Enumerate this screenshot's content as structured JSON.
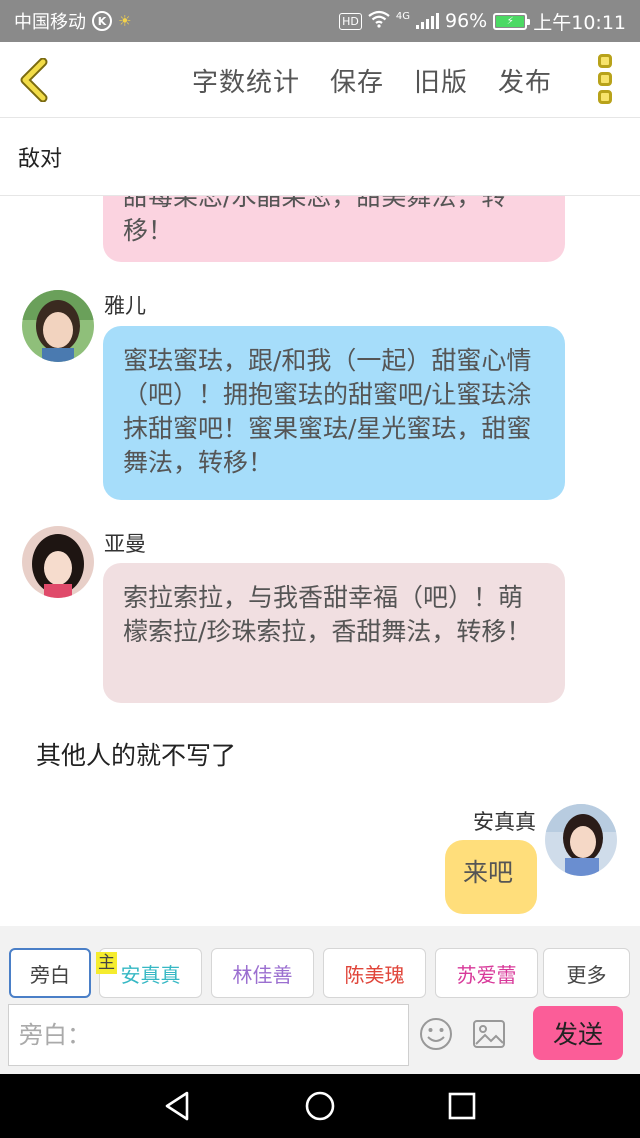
{
  "status_bar": {
    "carrier": "中国移动",
    "k_badge": "K",
    "hd": "HD",
    "network": "4G",
    "battery_percent": "96%",
    "time": "上午10:11",
    "icons": [
      "bulb-icon",
      "wifi-icon",
      "signal-icon",
      "battery-icon"
    ]
  },
  "toolbar": {
    "back_icon": "chevron-left-icon",
    "word_count_label": "字数统计",
    "save_label": "保存",
    "old_version_label": "旧版",
    "publish_label": "发布",
    "more_icon": "more-vertical-icon",
    "accent_color": "#e0c420"
  },
  "title": "敌对",
  "messages": [
    {
      "speaker": "",
      "text": "甜莓果恋/水晶果恋，甜美舞法，转移！",
      "visible_text": "转移！",
      "color": "#fbd3e0",
      "side": "left"
    },
    {
      "speaker": "雅儿",
      "text": "蜜珐蜜珐，跟/和我（一起）甜蜜心情（吧）！拥抱蜜珐的甜蜜吧/让蜜珐涂抹甜蜜吧！蜜果蜜珐/星光蜜珐，甜蜜舞法，转移！",
      "color": "#a6ddfa",
      "side": "left"
    },
    {
      "speaker": "亚曼",
      "text": "索拉索拉，与我香甜幸福（吧）！萌檬索拉/珍珠索拉，香甜舞法，转移！",
      "color": "#f1dfe1",
      "side": "left"
    },
    {
      "narration": "其他人的就不写了"
    },
    {
      "speaker": "安真真",
      "text": "来吧",
      "color": "#ffde7b",
      "side": "right"
    }
  ],
  "roles": {
    "main_tag": "主",
    "chips": [
      {
        "label": "旁白",
        "color": "#444444",
        "active": true
      },
      {
        "label": "安真真",
        "color": "#36b8c4",
        "active": false
      },
      {
        "label": "林佳善",
        "color": "#9b6fd0",
        "active": false
      },
      {
        "label": "陈美瑰",
        "color": "#e0453a",
        "active": false
      },
      {
        "label": "苏爱蕾",
        "color": "#d83a9a",
        "active": false
      },
      {
        "label": "更多",
        "color": "#444444",
        "active": false
      }
    ]
  },
  "input": {
    "placeholder": "旁白：",
    "value": "",
    "emoji_icon": "emoji-icon",
    "image_icon": "image-icon",
    "send_label": "发送",
    "send_color": "#fb5d98"
  },
  "navbar": {
    "back_icon": "triangle-back-icon",
    "home_icon": "circle-home-icon",
    "recents_icon": "square-recents-icon"
  }
}
